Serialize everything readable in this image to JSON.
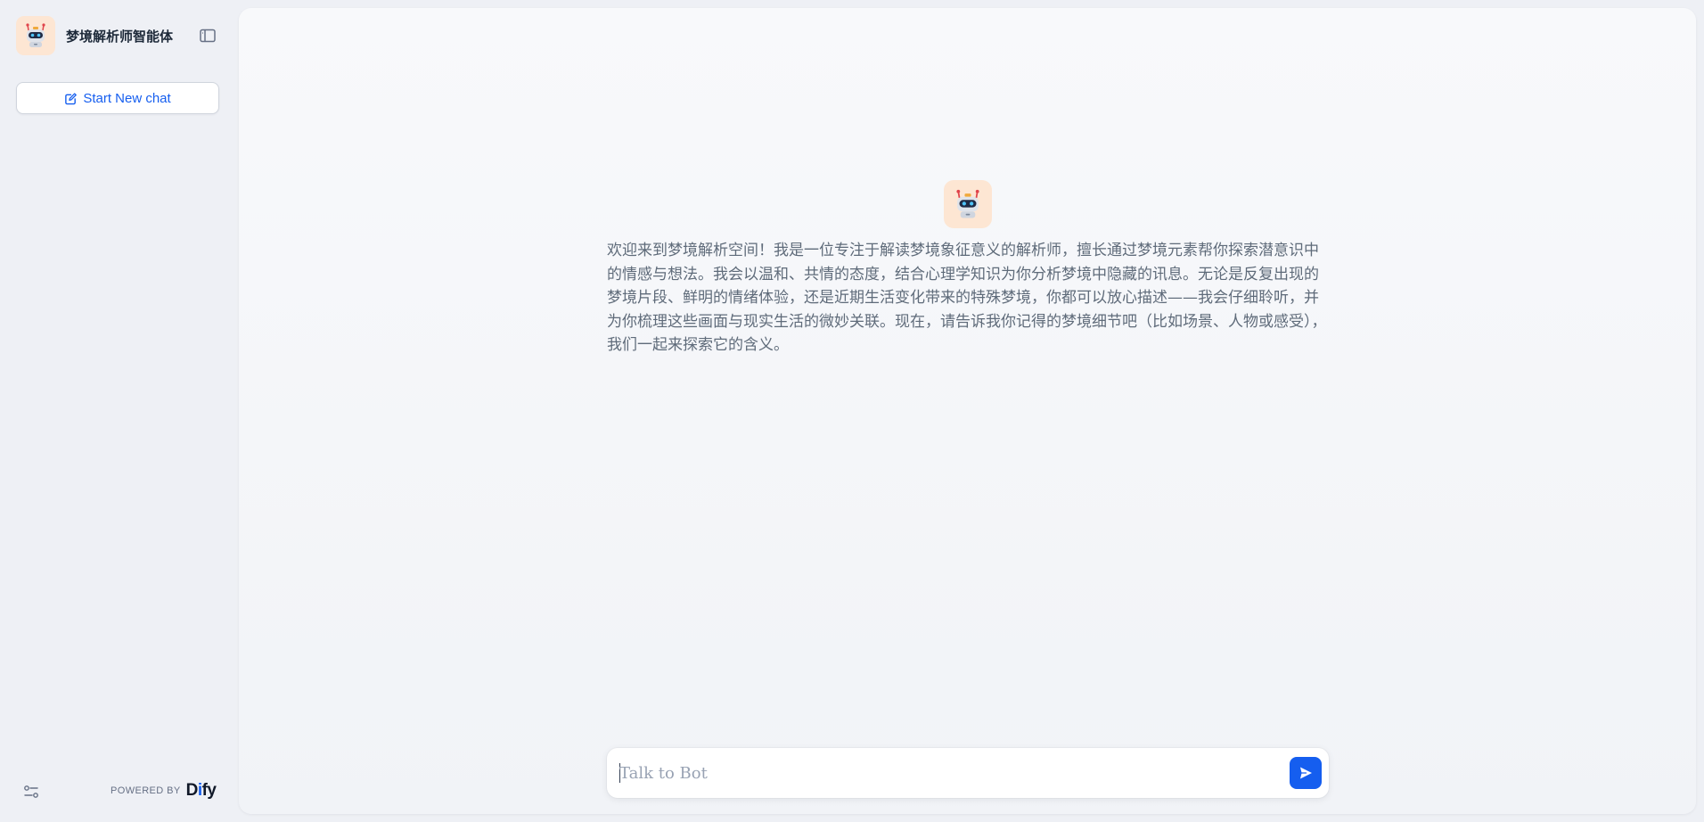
{
  "sidebar": {
    "app_title": "梦境解析师智能体",
    "new_chat_label": "Start New chat",
    "powered_by_label": "POWERED BY",
    "brand_logo_text": "Dify"
  },
  "main": {
    "welcome_message": "欢迎来到梦境解析空间！我是一位专注于解读梦境象征意义的解析师，擅长通过梦境元素帮你探索潜意识中的情感与想法。我会以温和、共情的态度，结合心理学知识为你分析梦境中隐藏的讯息。无论是反复出现的梦境片段、鲜明的情绪体验，还是近期生活变化带来的特殊梦境，你都可以放心描述——我会仔细聆听，并为你梳理这些画面与现实生活的微妙关联。现在，请告诉我你记得的梦境细节吧（比如场景、人物或感受），我们一起来探索它的含义。",
    "input_placeholder": "Talk to Bot",
    "input_value": ""
  },
  "colors": {
    "accent": "#155eef",
    "avatar_bg": "#fde6d3",
    "page_bg": "#eef0f5"
  },
  "icons": {
    "avatar": "robot-icon",
    "collapse": "sidebar-toggle-icon",
    "new_chat": "edit-icon",
    "settings": "sliders-icon",
    "send": "send-icon"
  }
}
